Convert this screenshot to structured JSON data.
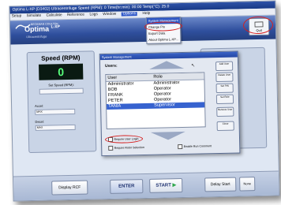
{
  "window": {
    "title": "Optima L-XP (D3402) Ultracentrifuge   Speed (RPM): 0   Time(hr:min): 00:00   Temp(°C): 25.0"
  },
  "menubar": {
    "items": [
      "Setup",
      "Simulate",
      "Calculate",
      "Reference",
      "Logs",
      "Window",
      "Options",
      "Help"
    ],
    "active": "Options"
  },
  "options_menu": {
    "items": [
      "System Management",
      "Change Pin",
      "Export Data",
      "About Optima L-XP..."
    ],
    "selected_index": 0
  },
  "header": {
    "company": "BECKMAN COULTER",
    "product": "Optima",
    "product_suffix": "L-XP",
    "tagline": "Ultracentrifuge",
    "right_button": "Quit"
  },
  "speed_panel": {
    "title": "Speed (RPM)",
    "value": "0",
    "set_speed_label": "Set Speed (RPM):",
    "accel_label": "Accel:",
    "accel_value": "MAX",
    "decel_label": "Decel:",
    "decel_value": "MAX"
  },
  "dialog": {
    "title": "System Management",
    "users_label": "Users:",
    "columns": [
      "User",
      "Role"
    ],
    "rows": [
      {
        "user": "Administrator",
        "role": "Administrator"
      },
      {
        "user": "BOB",
        "role": "Operator"
      },
      {
        "user": "FRANK",
        "role": "Operator"
      },
      {
        "user": "PETER",
        "role": "Operator"
      },
      {
        "user": "TANIA",
        "role": "Supervisor"
      }
    ],
    "selected_row": 4,
    "side_buttons": [
      "Add User",
      "Delete User",
      "Set PIN",
      "Set Role",
      "Remove User",
      "Close"
    ],
    "require_user_login": "Require User Login",
    "require_rotor_selection": "Require Rotor Selection",
    "enable_run_comment": "Enable Run Comment"
  },
  "bottombar": {
    "display_rcf": "Display RCF",
    "enter": "ENTER",
    "start": "START",
    "delay_start": "Delay Start",
    "none": "None"
  },
  "colors": {
    "header_blue": "#2f4f9d",
    "selection_blue": "#3662cf",
    "speed_display_green": "#58ff7c",
    "highlight_red": "#d42020"
  }
}
